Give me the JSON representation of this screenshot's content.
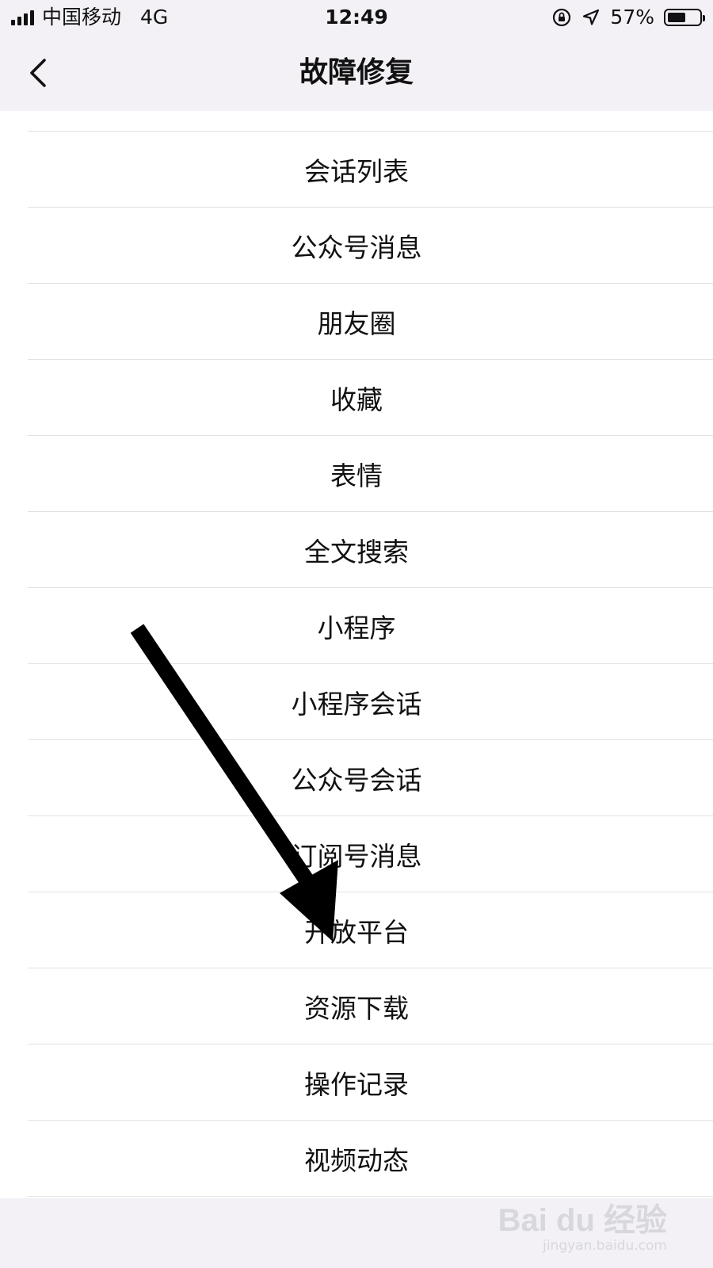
{
  "status_bar": {
    "carrier": "中国移动",
    "network": "4G",
    "time": "12:49",
    "battery_percent": "57%",
    "battery_level": 0.57,
    "icons": [
      "signal-icon",
      "orientation-lock-icon",
      "location-icon",
      "battery-icon"
    ]
  },
  "nav": {
    "title": "故障修复",
    "back_icon": "chevron-left-icon"
  },
  "list": {
    "items": [
      "会话列表",
      "公众号消息",
      "朋友圈",
      "收藏",
      "表情",
      "全文搜索",
      "小程序",
      "小程序会话",
      "公众号会话",
      "订阅号消息",
      "开放平台",
      "资源下载",
      "操作记录",
      "视频动态"
    ]
  },
  "annotation": {
    "icon": "arrow-pointer-icon",
    "color": "#000000"
  },
  "watermark": {
    "logo": "Bai du 经验",
    "url": "jingyan.baidu.com"
  }
}
